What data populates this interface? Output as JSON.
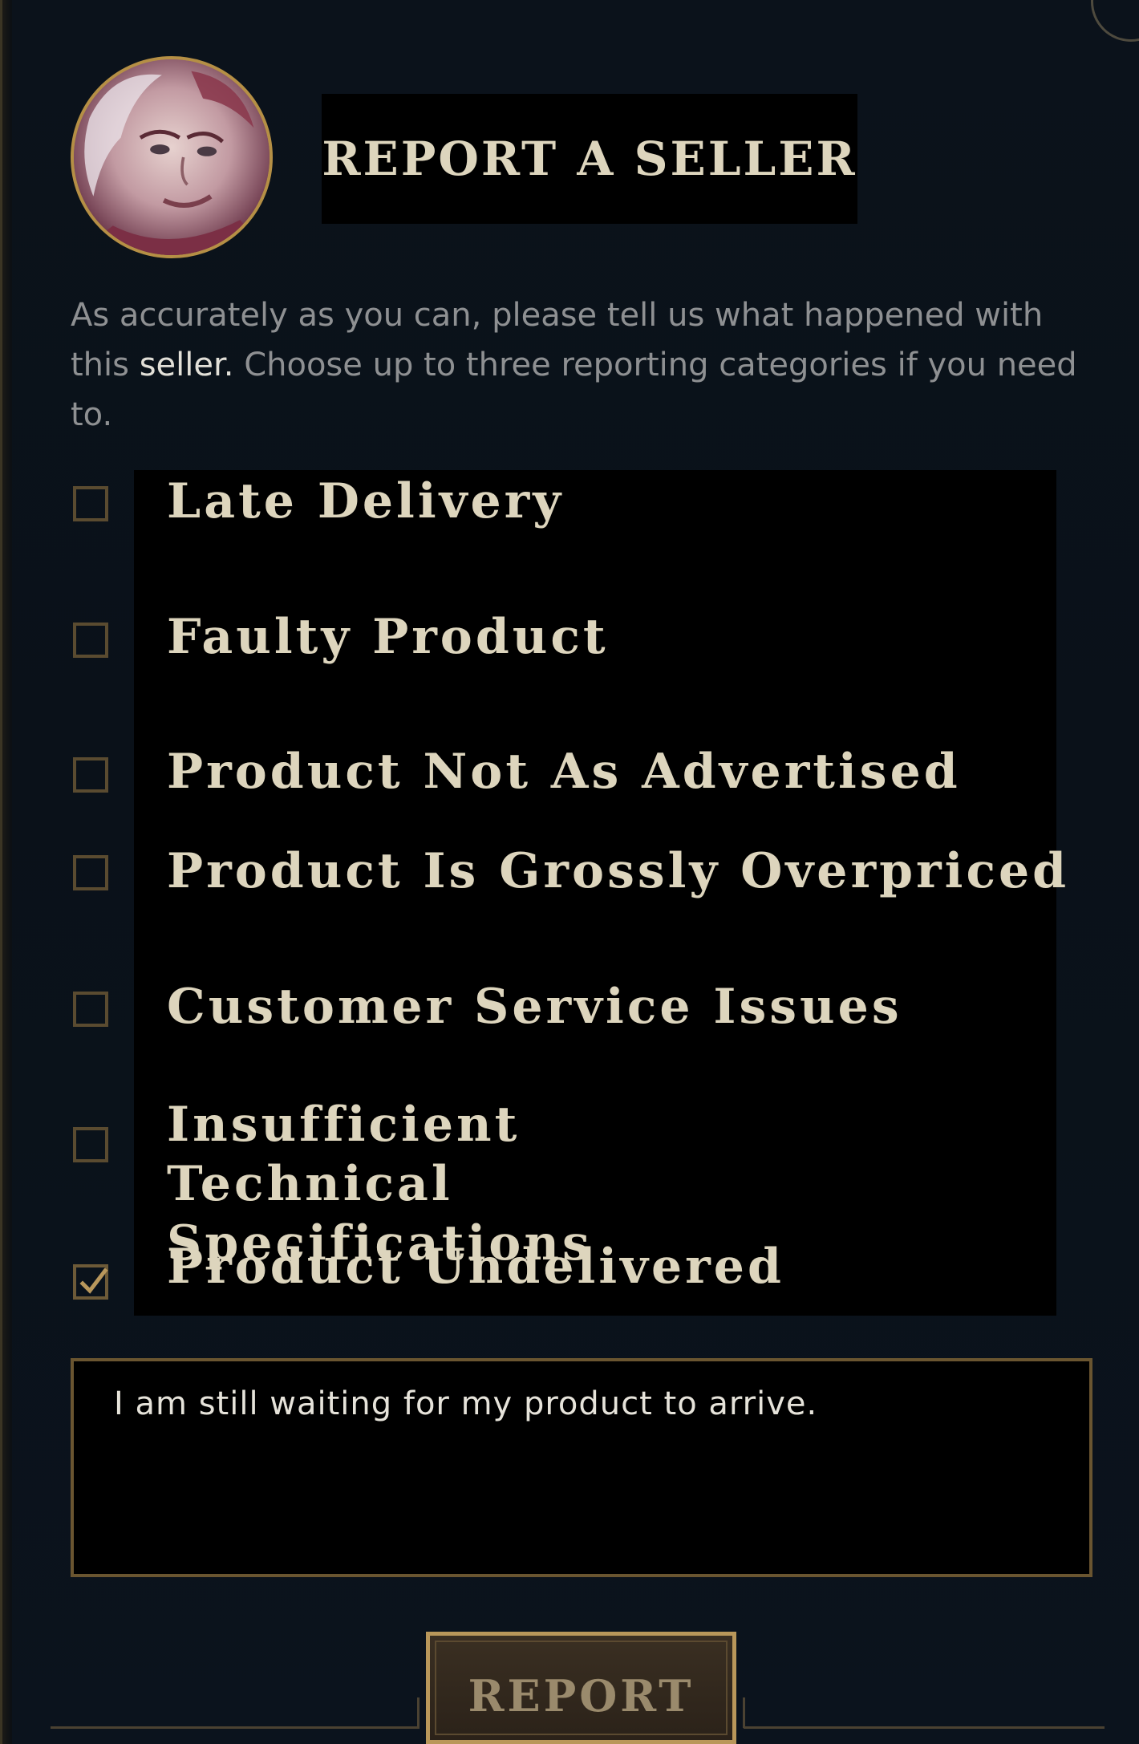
{
  "dialog": {
    "title": "REPORT A SELLER",
    "description_part1": "As accurately as you can, please tell us what happened with this ",
    "description_highlight": "seller.",
    "description_part2": " Choose up to three reporting categories if you need to."
  },
  "categories": [
    {
      "label": "Late Delivery",
      "checked": false
    },
    {
      "label": "Faulty Product",
      "checked": false
    },
    {
      "label": "Product Not As Advertised",
      "checked": false
    },
    {
      "label": "Product Is Grossly Overpriced",
      "checked": false
    },
    {
      "label": "Customer Service Issues",
      "checked": false
    },
    {
      "label": "Insufficient Technical Specifications",
      "checked": false
    },
    {
      "label": "Product Undelivered",
      "checked": true
    }
  ],
  "comment": {
    "value": "I am still waiting for my product to arrive."
  },
  "report_button": {
    "label": "REPORT"
  },
  "colors": {
    "background": "#0a1119",
    "gold_border": "#b58f45",
    "label_text": "#ddd5bd",
    "check_mark": "#b8975c"
  }
}
